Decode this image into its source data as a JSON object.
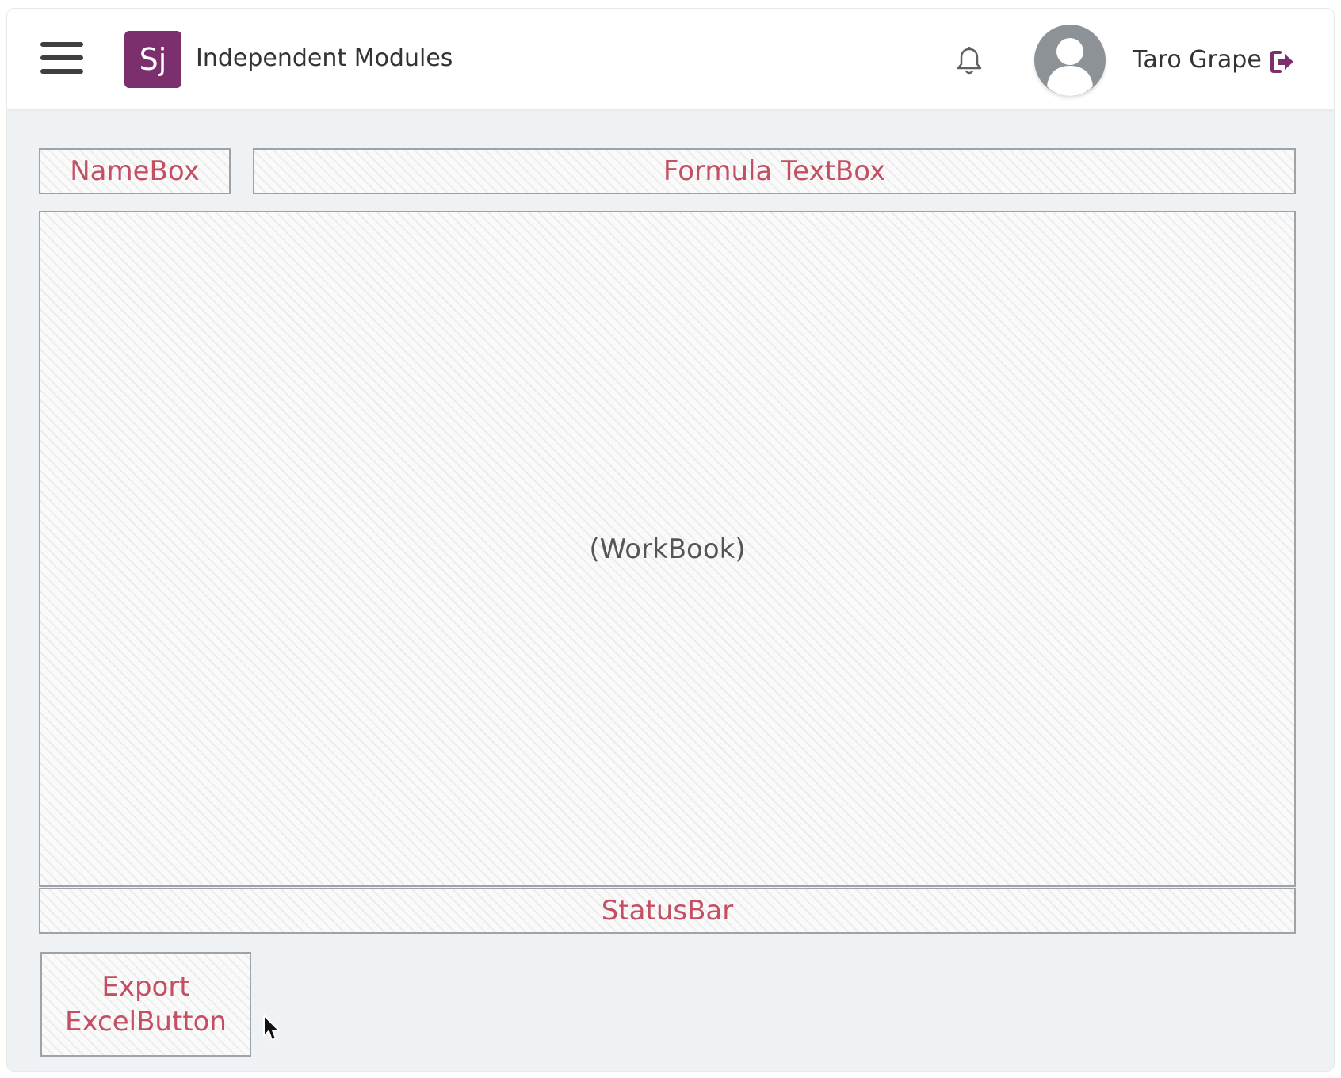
{
  "header": {
    "logo_text": "Sj",
    "title": "Independent Modules",
    "user_name": "Taro Grape"
  },
  "modules": {
    "namebox": "NameBox",
    "formula_textbox": "Formula TextBox",
    "workbook": "(WorkBook)",
    "statusbar": "StatusBar",
    "export_button": "Export ExcelButton"
  },
  "colors": {
    "brand": "#7b2f6c",
    "label_accent": "#c44f63",
    "background": "#eff2f5"
  },
  "icons": [
    "menu-icon",
    "bell-icon",
    "avatar-icon",
    "logout-icon",
    "mouse-cursor-icon"
  ]
}
